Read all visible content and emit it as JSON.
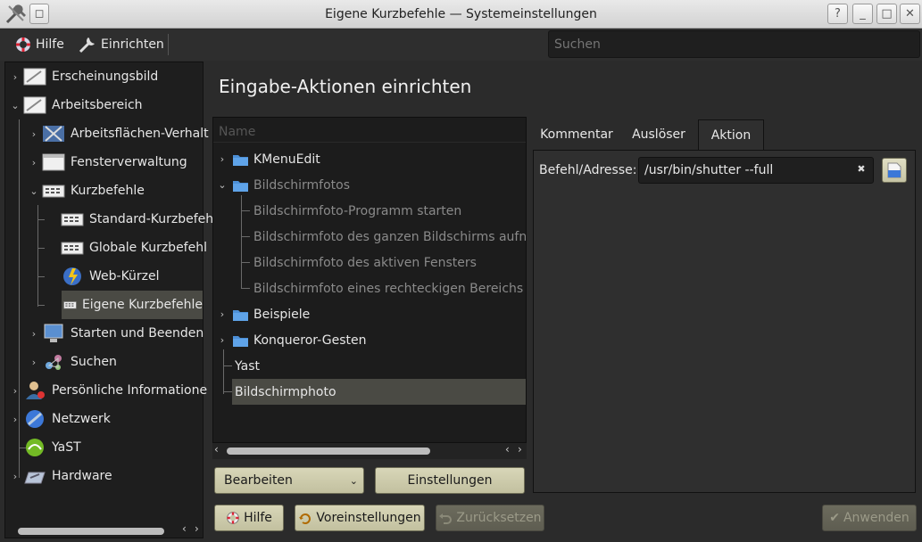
{
  "window": {
    "title": "Eigene Kurzbefehle — Systemeinstellungen"
  },
  "titlebar_buttons": {
    "help": "?",
    "minimize": "_",
    "maximize": "□",
    "close": "✕"
  },
  "toolbar": {
    "help_label": "Hilfe",
    "configure_label": "Einrichten",
    "search_placeholder": "Suchen"
  },
  "sidebar": {
    "items": [
      {
        "label": "Erscheinungsbild",
        "icon": "appearance-icon"
      },
      {
        "label": "Arbeitsbereich",
        "icon": "workspace-icon"
      },
      {
        "label": "Arbeitsflächen-Verhalt",
        "icon": "desktop-behavior-icon"
      },
      {
        "label": "Fensterverwaltung",
        "icon": "window-management-icon"
      },
      {
        "label": "Kurzbefehle",
        "icon": "keyboard-icon"
      },
      {
        "label": "Standard-Kurzbefeh",
        "icon": "keyboard-icon"
      },
      {
        "label": "Globale Kurzbefehl",
        "icon": "keyboard-icon"
      },
      {
        "label": "Web-Kürzel",
        "icon": "web-icon"
      },
      {
        "label": "Eigene Kurzbefehle",
        "icon": "keyboard-icon"
      },
      {
        "label": "Starten und Beenden",
        "icon": "startup-icon"
      },
      {
        "label": "Suchen",
        "icon": "search-icon"
      },
      {
        "label": "Persönliche Informatione",
        "icon": "personal-icon"
      },
      {
        "label": "Netzwerk",
        "icon": "network-icon"
      },
      {
        "label": "YaST",
        "icon": "yast-icon"
      },
      {
        "label": "Hardware",
        "icon": "hardware-icon"
      }
    ]
  },
  "main": {
    "title": "Eingabe-Aktionen einrichten",
    "list_header": "Name",
    "list_items": [
      {
        "label": "KMenuEdit"
      },
      {
        "label": "Bildschirmfotos"
      },
      {
        "label": "Bildschirmfoto-Programm starten"
      },
      {
        "label": "Bildschirmfoto des ganzen Bildschirms aufneh"
      },
      {
        "label": "Bildschirmfoto des aktiven Fensters"
      },
      {
        "label": "Bildschirmfoto eines rechteckigen Bereichs"
      },
      {
        "label": "Beispiele"
      },
      {
        "label": "Konqueror-Gesten"
      },
      {
        "label": "Yast"
      },
      {
        "label": "Bildschirmphoto"
      }
    ],
    "edit_button": "Bearbeiten",
    "settings_button": "Einstellungen"
  },
  "tabs": [
    {
      "label": "Kommentar"
    },
    {
      "label": "Auslöser"
    },
    {
      "label": "Aktion"
    }
  ],
  "action": {
    "command_label": "Befehl/Adresse:",
    "command_value": "/usr/bin/shutter --full"
  },
  "footer": {
    "help": "Hilfe",
    "defaults": "Voreinstellungen",
    "reset": "Zurücksetzen",
    "apply": "Anwenden"
  },
  "colors": {
    "selection": "#4a4a44",
    "button": "#d2d0b2",
    "background": "#2b2b2b"
  }
}
